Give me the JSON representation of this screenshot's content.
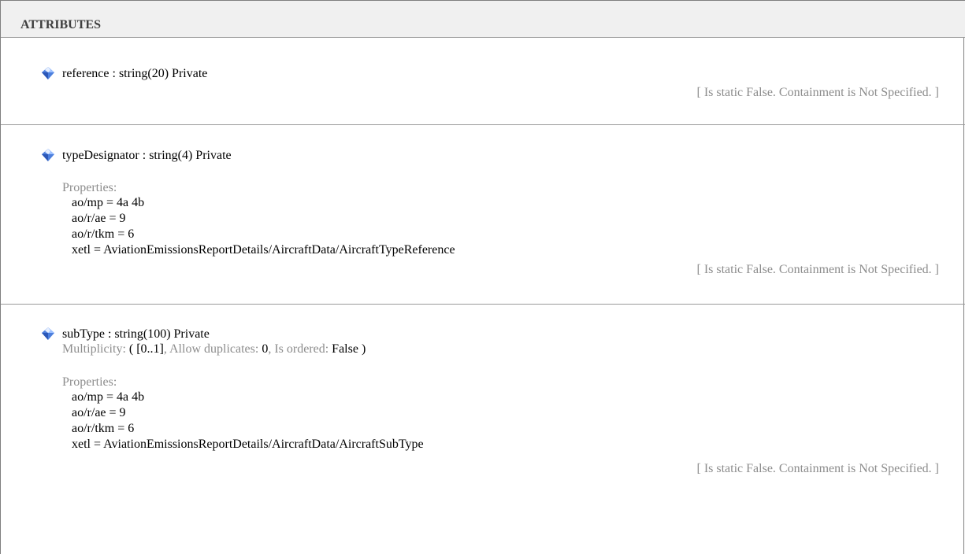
{
  "section": {
    "title": "ATTRIBUTES"
  },
  "attributes": [
    {
      "signature": "reference : string(20)  Private",
      "footer": "[ Is static False. Containment is Not Specified. ]"
    },
    {
      "signature": "typeDesignator : string(4)  Private",
      "properties_label": "Properties:",
      "properties": [
        "ao/mp = 4a 4b",
        "ao/r/ae = 9",
        "ao/r/tkm = 6",
        "xetl = AviationEmissionsReportDetails/AircraftData/AircraftTypeReference"
      ],
      "footer": "[ Is static False. Containment is Not Specified. ]"
    },
    {
      "signature": "subType : string(100)  Private",
      "multiplicity": {
        "label": "Multiplicity:",
        "open": " (  ",
        "range": "[0..1]",
        "dup_label": ", Allow duplicates:",
        "dup_value": " 0",
        "ord_label": ", Is ordered:",
        "ord_value": " False",
        "close": " )"
      },
      "properties_label": "Properties:",
      "properties": [
        "ao/mp = 4a 4b",
        "ao/r/ae = 9",
        "ao/r/tkm = 6",
        "xetl = AviationEmissionsReportDetails/AircraftData/AircraftSubType"
      ],
      "footer": "[ Is static False. Containment is Not Specified. ]"
    }
  ],
  "icon": {
    "name": "attribute-diamond-icon",
    "color_light": "#cfe0ff",
    "color_dark": "#3e6fd0"
  }
}
